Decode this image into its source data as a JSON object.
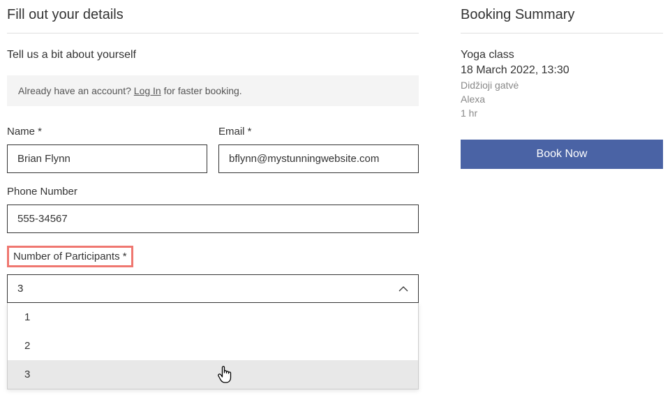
{
  "form": {
    "title": "Fill out your details",
    "subtitle": "Tell us a bit about yourself",
    "accountBanner": {
      "prefix": "Already have an account? ",
      "loginLink": "Log In",
      "suffix": " for faster booking."
    },
    "fields": {
      "name": {
        "label": "Name *",
        "value": "Brian Flynn"
      },
      "email": {
        "label": "Email *",
        "value": "bflynn@mystunningwebsite.com"
      },
      "phone": {
        "label": "Phone Number",
        "value": "555-34567"
      },
      "participants": {
        "label": "Number of Participants *",
        "selected": "3",
        "options": [
          "1",
          "2",
          "3"
        ]
      }
    }
  },
  "summary": {
    "title": "Booking Summary",
    "service": "Yoga class",
    "datetime": "18 March 2022, 13:30",
    "location": "Didžioji gatvė",
    "staff": "Alexa",
    "duration": "1 hr",
    "bookButton": "Book Now"
  }
}
